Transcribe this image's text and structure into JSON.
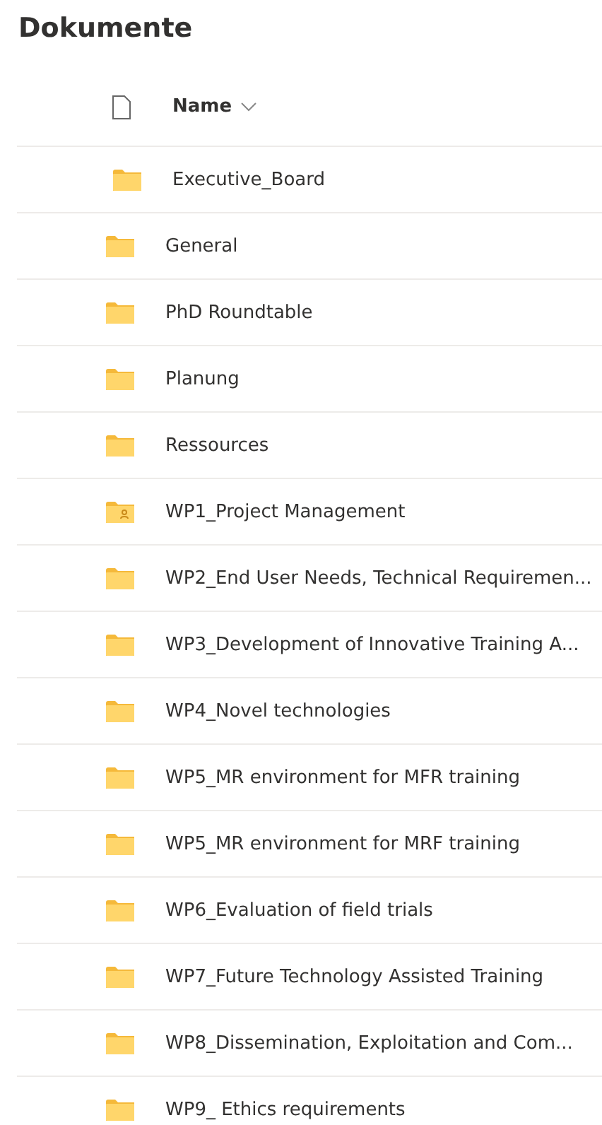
{
  "title": "Dokumente",
  "header": {
    "column": "Name"
  },
  "rows": [
    {
      "name": "Executive_Board",
      "kind": "folder"
    },
    {
      "name": "General",
      "kind": "folder"
    },
    {
      "name": "PhD Roundtable",
      "kind": "folder"
    },
    {
      "name": "Planung",
      "kind": "folder"
    },
    {
      "name": "Ressources",
      "kind": "folder"
    },
    {
      "name": "WP1_Project Management",
      "kind": "shared"
    },
    {
      "name": "WP2_End User Needs, Technical Requiremen...",
      "kind": "folder"
    },
    {
      "name": "WP3_Development of Innovative Training A...",
      "kind": "folder"
    },
    {
      "name": "WP4_Novel technologies",
      "kind": "folder"
    },
    {
      "name": "WP5_MR environment for MFR training",
      "kind": "folder"
    },
    {
      "name": "WP5_MR environment for MRF training",
      "kind": "folder"
    },
    {
      "name": "WP6_Evaluation of field trials",
      "kind": "folder"
    },
    {
      "name": "WP7_Future Technology Assisted Training",
      "kind": "folder"
    },
    {
      "name": "WP8_Dissemination, Exploitation and Com...",
      "kind": "folder"
    },
    {
      "name": "WP9_ Ethics requirements",
      "kind": "folder"
    }
  ]
}
